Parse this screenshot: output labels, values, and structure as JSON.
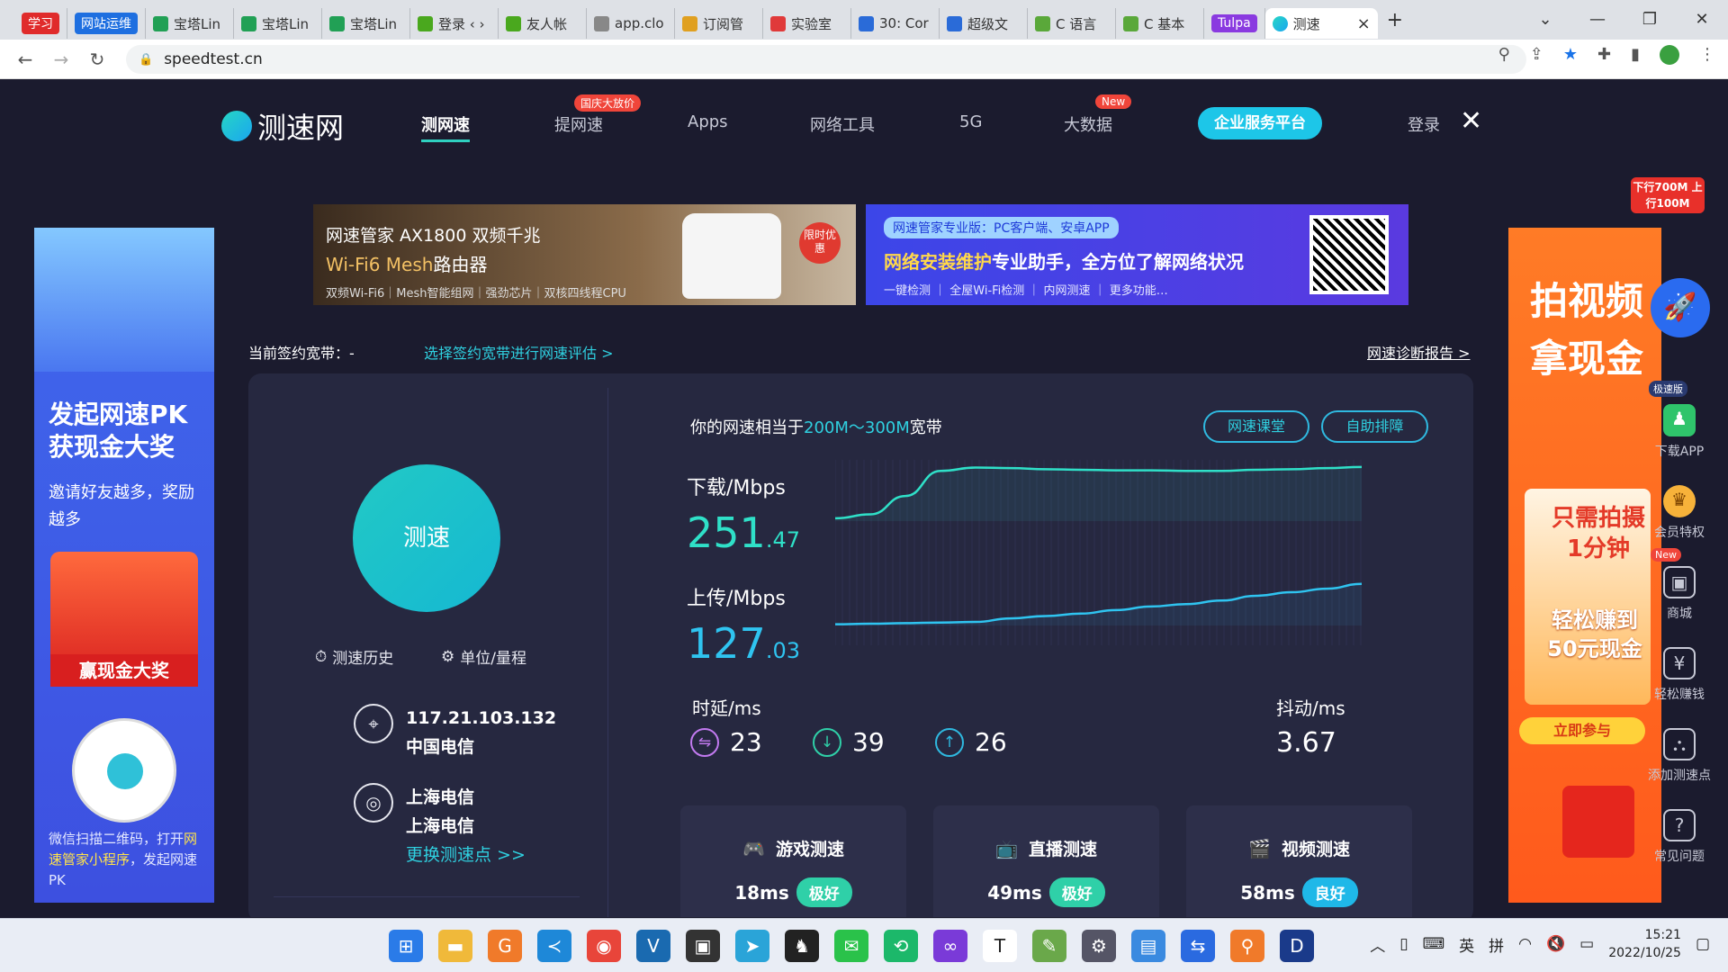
{
  "browser": {
    "tabs": [
      {
        "label": "学习",
        "color": "#e02b2b",
        "kind": "chip"
      },
      {
        "label": "网站运维",
        "color": "#1e6fe0",
        "kind": "chip"
      },
      {
        "label": "宝塔Lin",
        "color": "#21a055"
      },
      {
        "label": "宝塔Lin",
        "color": "#21a055"
      },
      {
        "label": "宝塔Lin",
        "color": "#21a055"
      },
      {
        "label": "登录 ‹ ›",
        "color": "#4aa81e"
      },
      {
        "label": "友人帐",
        "color": "#4aa81e"
      },
      {
        "label": "app.clo",
        "color": "#888888"
      },
      {
        "label": "订阅管",
        "color": "#e0a020"
      },
      {
        "label": "实验室",
        "color": "#e03a3a"
      },
      {
        "label": "30: Cor",
        "color": "#2a6bd8"
      },
      {
        "label": "超级文",
        "color": "#2a6bd8"
      },
      {
        "label": "C 语言",
        "color": "#5aa83a"
      },
      {
        "label": "C 基本",
        "color": "#5aa83a"
      },
      {
        "label": "Tulpa",
        "color": "#8a3ae0",
        "kind": "chip"
      }
    ],
    "active_tab": {
      "label": "测速",
      "close": "×"
    },
    "new_tab": "+",
    "window_controls": [
      "⌄",
      "—",
      "❐",
      "✕"
    ],
    "url": "speedtest.cn"
  },
  "site": {
    "logo_text": "测速网",
    "nav": [
      {
        "label": "测网速",
        "active": true
      },
      {
        "label": "提网速",
        "badge": "国庆大放价"
      },
      {
        "label": "Apps"
      },
      {
        "label": "网络工具"
      },
      {
        "label": "5G"
      },
      {
        "label": "大数据",
        "badge": "New"
      }
    ],
    "enterprise_button": "企业服务平台",
    "login": "登录",
    "close": "✕"
  },
  "banners": {
    "left": {
      "title": "网速管家 AX1800 双频千兆",
      "subtitle_highlight": "Wi-Fi6 Mesh",
      "subtitle_rest": "路由器",
      "features": "双频Wi-Fi6｜Mesh智能组网｜强劲芯片｜双核四线程CPU",
      "badge": "限时优惠"
    },
    "right": {
      "tag": "网速管家专业版：PC客户端、安卓APP",
      "title_highlight": "网络安装维护",
      "title_rest": "专业助手，全方位了解网络状况",
      "features": "一键检测 ｜ 全屋Wi-Fi检测 ｜ 内网测速 ｜ 更多功能…"
    }
  },
  "left_ad": {
    "headline": "发起网速PK获现金大奖",
    "sub": "邀请好友越多，奖励越多",
    "redpack_label": "赢现金大奖",
    "footer_prefix": "微信扫描二维码，打开",
    "footer_highlight": "网速管家小程序",
    "footer_suffix": "，发起网速PK"
  },
  "right_ad": {
    "headline": "拍视频拿现金",
    "card_top": "只需拍摄1分钟",
    "card_bottom": "轻松赚到50元现金",
    "join_button": "立即参与",
    "promo_badge": "下行700M 上行100M"
  },
  "right_tools": [
    {
      "label": "下载APP",
      "badge": "极速版",
      "icon": "android-icon"
    },
    {
      "label": "会员特权",
      "icon": "crown-icon"
    },
    {
      "label": "商城",
      "badge": "New",
      "icon": "shop-icon"
    },
    {
      "label": "轻松赚钱",
      "icon": "money-bag-icon"
    },
    {
      "label": "添加测速点",
      "icon": "network-icon"
    },
    {
      "label": "常见问题",
      "icon": "question-icon"
    }
  ],
  "contract": {
    "label": "当前签约宽带：-",
    "link": "选择签约宽带进行网速评估 >",
    "report": "网速诊断报告 >"
  },
  "speedtest": {
    "start_button": "测速",
    "history": "测速历史",
    "units": "单位/量程",
    "ip": "117.21.103.132",
    "isp": "中国电信",
    "node_line1": "上海电信",
    "node_line2": "上海电信",
    "change_node": "更换测速点 >>",
    "equivalent_prefix": "你的网速相当于",
    "equivalent_value": "200M～300M",
    "equivalent_suffix": "宽带",
    "class_button": "网速课堂",
    "selfcheck_button": "自助排障",
    "download_label": "下载/Mbps",
    "download_int": "251",
    "download_dec": ".47",
    "upload_label": "上传/Mbps",
    "upload_int": "127",
    "upload_dec": ".03",
    "latency_label": "时延/ms",
    "latency": "23",
    "latency_down": "39",
    "latency_up": "26",
    "jitter_label": "抖动/ms",
    "jitter": "3.67"
  },
  "chart_data": {
    "type": "line",
    "series": [
      {
        "values": [
          0.05,
          0.12,
          0.45,
          0.9,
          0.96,
          0.95,
          0.93,
          0.92,
          0.91,
          0.91,
          0.9,
          0.9,
          0.92,
          0.93,
          0.95,
          0.97
        ],
        "color": "#2fe0c8"
      },
      {
        "values": [
          0.02,
          0.03,
          0.04,
          0.05,
          0.06,
          0.12,
          0.16,
          0.2,
          0.26,
          0.32,
          0.36,
          0.42,
          0.5,
          0.56,
          0.62,
          0.7
        ],
        "color": "#2fc4f0"
      }
    ]
  },
  "quality_cards": [
    {
      "title": "游戏测速",
      "icon": "gamepad-icon",
      "value": "18ms",
      "rating": "极好",
      "rating_color": "#2fd0a8"
    },
    {
      "title": "直播测速",
      "icon": "tv-icon",
      "value": "49ms",
      "rating": "极好",
      "rating_color": "#2fd0a8"
    },
    {
      "title": "视频测速",
      "icon": "video-icon",
      "value": "58ms",
      "rating": "良好",
      "rating_color": "#1fb8e8"
    }
  ],
  "taskbar": {
    "time": "15:21",
    "date": "2022/10/25",
    "ime1": "英",
    "ime2": "拼"
  }
}
